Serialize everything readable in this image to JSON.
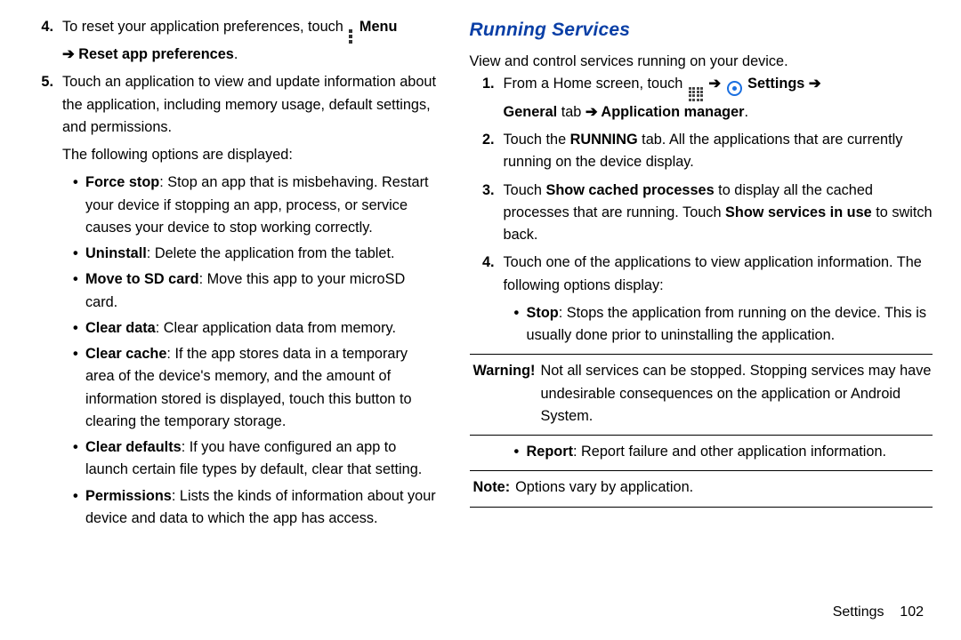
{
  "left": {
    "ol": [
      {
        "n": "4.",
        "pre": "To reset your application preferences, touch ",
        "tail_bold": " Menu",
        "line2_bold1": "Reset app preferences",
        "line2_rest": "."
      },
      {
        "n": "5.",
        "text": "Touch an application to view and update information about the application, including memory usage, default settings, and permissions."
      }
    ],
    "sub_para": "The following options are displayed:",
    "bullets": [
      {
        "b": "Force stop",
        "t": ": Stop an app that is misbehaving. Restart your device if stopping an app, process, or service causes your device to stop working correctly."
      },
      {
        "b": "Uninstall",
        "t": ": Delete the application from the tablet."
      },
      {
        "b": "Move to SD card",
        "t": ": Move this app to your microSD card."
      },
      {
        "b": "Clear data",
        "t": ": Clear application data from memory."
      },
      {
        "b": "Clear cache",
        "t": ": If the app stores data in a temporary area of the device's memory, and the amount of information stored is displayed, touch this button to clearing the temporary storage."
      },
      {
        "b": "Clear defaults",
        "t": ": If you have configured an app to launch certain file types by default, clear that setting."
      },
      {
        "b": "Permissions",
        "t": ": Lists the kinds of information about your device and data to which the app has access."
      }
    ]
  },
  "right": {
    "heading": "Running Services",
    "intro": "View and control services running on your device.",
    "ol": [
      {
        "n": "1.",
        "pre": "From a Home screen, touch ",
        "arrow1": "➔",
        "bold1": " Settings ",
        "arrow2": "➔",
        "line2_b1": "General",
        "line2_mid": " tab ",
        "line2_arrow": "➔",
        "line2_b2": " Application manager",
        "line2_end": "."
      },
      {
        "n": "2.",
        "pre": "Touch the ",
        "bold1": "RUNNING",
        "post": " tab. All the applications that are currently running on the device display."
      },
      {
        "n": "3.",
        "pre": "Touch ",
        "bold1": "Show cached processes",
        "mid": " to display all the cached processes that are running. Touch ",
        "bold2": "Show services in use",
        "post": " to switch back."
      },
      {
        "n": "4.",
        "text": "Touch one of the applications to view application information. The following options display:"
      }
    ],
    "bullet_stop": {
      "b": "Stop",
      "t": ": Stops the application from running on the device. This is usually done prior to uninstalling the application."
    },
    "warning_label": "Warning!",
    "warning_text": "Not all services can be stopped. Stopping services may have undesirable consequences on the application or Android System.",
    "bullet_report": {
      "b": "Report",
      "t": ": Report failure and other application information."
    },
    "note_label": "Note:",
    "note_text": "Options vary by application."
  },
  "footer": {
    "section": "Settings",
    "page": "102"
  },
  "glyphs": {
    "arrow": "➔",
    "bullet": "•"
  }
}
